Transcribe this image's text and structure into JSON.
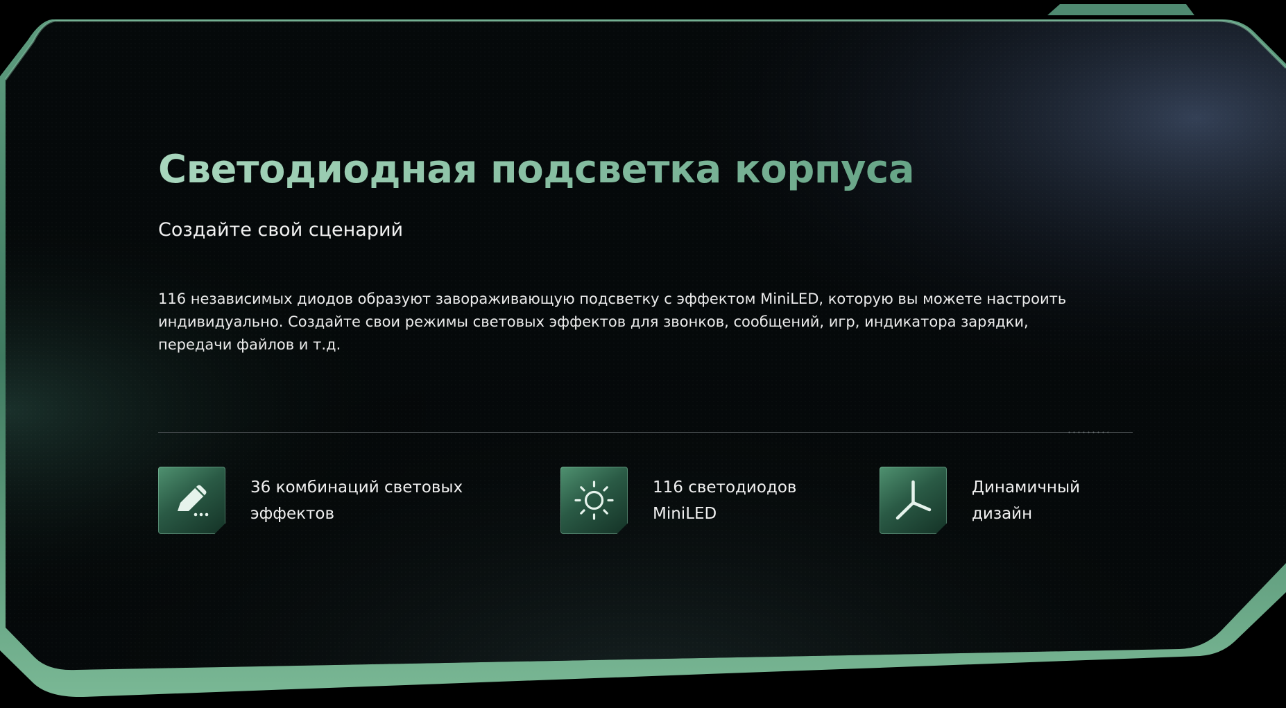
{
  "headline": "Светодиодная подсветка корпуса",
  "subheadline": "Создайте свой сценарий",
  "description": "116 независимых диодов образуют завораживающую подсветку с эффектом MiniLED, которую вы можете настроить индивидуально. Создайте свои режимы световых эффектов для звонков, сообщений, игр, индикатора зарядки, передачи файлов и т.д.",
  "features": [
    {
      "icon": "pencil-icon",
      "line1": "36 комбинаций световых",
      "line2": "эффектов"
    },
    {
      "icon": "sun-icon",
      "line1": "116 светодиодов",
      "line2": "MiniLED"
    },
    {
      "icon": "y-shape-icon",
      "line1": "Динамичный",
      "line2": "дизайн"
    }
  ],
  "colors": {
    "accent_green": "#7fb898",
    "headline_gradient_start": "#a8d6bd",
    "headline_gradient_end": "#66a486",
    "panel_dark": "#05090a",
    "background": "#000000",
    "text_primary": "#f0f0f0"
  }
}
